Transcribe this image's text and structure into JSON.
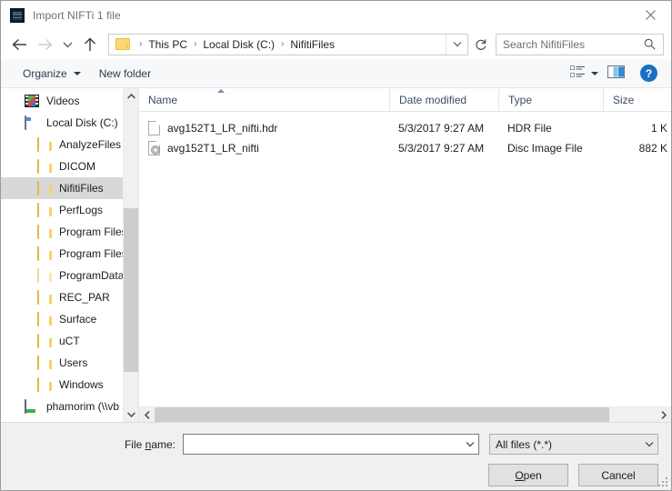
{
  "window": {
    "title": "Import NIFTi 1 file",
    "icon": "app-stack-icon",
    "close_label": "✕"
  },
  "nav": {
    "back_icon": "arrow-left-icon",
    "forward_icon": "arrow-right-icon",
    "recent_icon": "chevron-down-icon",
    "up_icon": "arrow-up-icon",
    "refresh_icon": "refresh-icon",
    "breadcrumb": [
      "This PC",
      "Local Disk (C:)",
      "NifitiFiles"
    ],
    "separator": "›"
  },
  "search": {
    "placeholder": "Search NifitiFiles",
    "value": "",
    "icon": "search-icon"
  },
  "toolbar": {
    "organize_label": "Organize",
    "new_folder_label": "New folder",
    "view_icon": "view-options-icon",
    "preview_icon": "preview-pane-icon",
    "help_label": "?"
  },
  "sidebar": {
    "items": [
      {
        "label": "Videos",
        "icon": "videos-icon",
        "indent": 1,
        "selected": false
      },
      {
        "label": "Local Disk (C:)",
        "icon": "drive-icon",
        "indent": 1,
        "selected": false
      },
      {
        "label": "AnalyzeFiles",
        "icon": "folder-icon",
        "indent": 2,
        "selected": false
      },
      {
        "label": "DICOM",
        "icon": "folder-icon",
        "indent": 2,
        "selected": false
      },
      {
        "label": "NifitiFiles",
        "icon": "folder-icon",
        "indent": 2,
        "selected": true
      },
      {
        "label": "PerfLogs",
        "icon": "folder-icon",
        "indent": 2,
        "selected": false
      },
      {
        "label": "Program Files",
        "icon": "folder-icon",
        "indent": 2,
        "selected": false
      },
      {
        "label": "Program Files (",
        "icon": "folder-icon",
        "indent": 2,
        "selected": false
      },
      {
        "label": "ProgramData",
        "icon": "folder-faded-icon",
        "indent": 2,
        "selected": false
      },
      {
        "label": "REC_PAR",
        "icon": "folder-icon",
        "indent": 2,
        "selected": false
      },
      {
        "label": "Surface",
        "icon": "folder-icon",
        "indent": 2,
        "selected": false
      },
      {
        "label": "uCT",
        "icon": "folder-icon",
        "indent": 2,
        "selected": false
      },
      {
        "label": "Users",
        "icon": "folder-icon",
        "indent": 2,
        "selected": false
      },
      {
        "label": "Windows",
        "icon": "folder-icon",
        "indent": 2,
        "selected": false
      },
      {
        "label": "phamorim (\\\\vb",
        "icon": "network-drive-icon",
        "indent": 1,
        "selected": false
      }
    ]
  },
  "filelist": {
    "columns": [
      "Name",
      "Date modified",
      "Type",
      "Size"
    ],
    "sorted_by": "Name",
    "sort_direction": "ascending",
    "rows": [
      {
        "name": "avg152T1_LR_nifti.hdr",
        "icon": "file-icon",
        "date_modified": "5/3/2017 9:27 AM",
        "type": "HDR File",
        "size": "1 K"
      },
      {
        "name": "avg152T1_LR_nifti",
        "icon": "disc-image-file-icon",
        "date_modified": "5/3/2017 9:27 AM",
        "type": "Disc Image File",
        "size": "882 K"
      }
    ]
  },
  "footer": {
    "filename_label_pre": "File ",
    "filename_label_accel": "n",
    "filename_label_post": "ame:",
    "filename_value": "",
    "filter_value": "All files (*.*)",
    "open_accel": "O",
    "open_rest": "pen",
    "cancel_label": "Cancel"
  },
  "colors": {
    "accent": "#1a6fc4",
    "selection": "#d8d8d8",
    "folder": "#fcd975",
    "header_text": "#3b4a63"
  }
}
